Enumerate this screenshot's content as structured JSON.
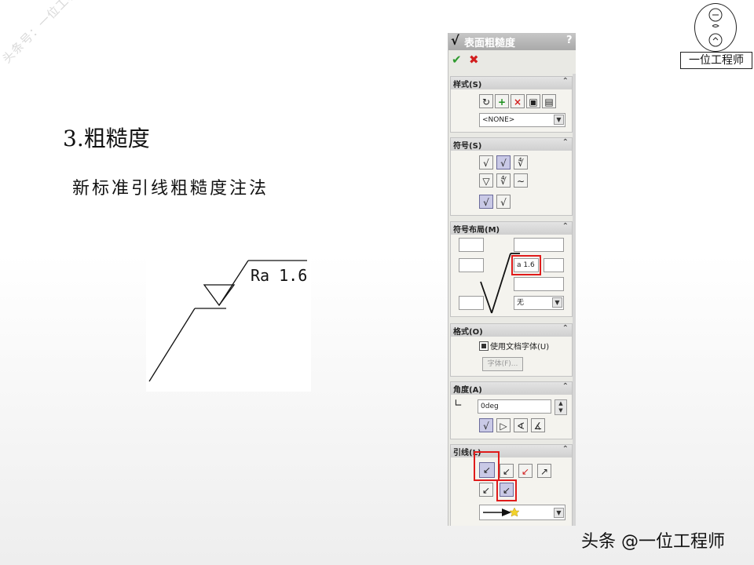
{
  "watermark": "头条号：一位工程师",
  "logo": {
    "name": "一位工程师"
  },
  "slide": {
    "heading": "3.粗糙度",
    "subheading": "新标准引线粗糙度注法",
    "drawing_label": "Ra 1.6"
  },
  "credit": "头条 @一位工程师",
  "panel": {
    "title": "表面粗糙度",
    "help": "?",
    "ok": "✔",
    "cancel": "✖",
    "style": {
      "label": "样式(S)",
      "dropdown_value": "<NONE>"
    },
    "symbol": {
      "label": "符号(S)"
    },
    "symbol_layout": {
      "label": "符号布局(M)",
      "roughness_value": "a 1.6",
      "lay_dropdown": "无"
    },
    "format": {
      "label": "格式(O)",
      "use_doc_font": "使用文档字体(U)",
      "font_button": "字体(F)..."
    },
    "angle": {
      "label": "角度(A)",
      "value": "0deg"
    },
    "leader": {
      "label": "引线(L)"
    },
    "collapse_glyph": "⌃"
  },
  "colors": {
    "accent_red": "#e01b1b",
    "ok_green": "#2e9a2e"
  }
}
